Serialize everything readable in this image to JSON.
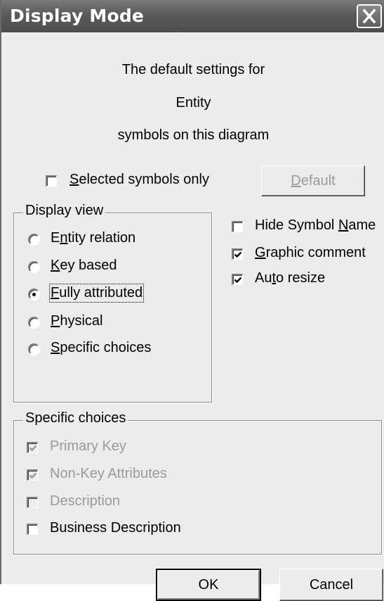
{
  "window": {
    "title": "Display Mode",
    "close_label": "Close"
  },
  "message": {
    "line1": "The default settings for",
    "line2": "Entity",
    "line3": "symbols on this diagram"
  },
  "selected_only": {
    "checked": false,
    "accel": "S",
    "rest": "elected symbols only"
  },
  "default_button": {
    "accel": "D",
    "rest": "efault",
    "disabled": true
  },
  "display_view": {
    "title": "Display view",
    "options": [
      {
        "pre": "E",
        "accel": "n",
        "post": "tity relation",
        "selected": false
      },
      {
        "pre": "",
        "accel": "K",
        "post": "ey based",
        "selected": false
      },
      {
        "pre": "",
        "accel": "F",
        "post": "ully attributed",
        "selected": true
      },
      {
        "pre": "",
        "accel": "P",
        "post": "hysical",
        "selected": false
      },
      {
        "pre": "",
        "accel": "S",
        "post": "pecific choices",
        "selected": false
      }
    ]
  },
  "options": [
    {
      "pre": "Hide Symbol ",
      "accel": "N",
      "post": "ame",
      "checked": false
    },
    {
      "pre": "",
      "accel": "G",
      "post": "raphic comment",
      "checked": true
    },
    {
      "pre": "Au",
      "accel": "t",
      "post": "o resize",
      "checked": true
    }
  ],
  "specific_choices": {
    "title": "Specific choices",
    "items": [
      {
        "label": "Primary Key",
        "checked": true,
        "disabled": true
      },
      {
        "label": "Non-Key Attributes",
        "checked": true,
        "disabled": true
      },
      {
        "label": "Description",
        "checked": false,
        "disabled": true
      },
      {
        "label": "Business Description",
        "checked": false,
        "disabled": false
      }
    ]
  },
  "buttons": {
    "ok": "OK",
    "cancel": "Cancel"
  }
}
